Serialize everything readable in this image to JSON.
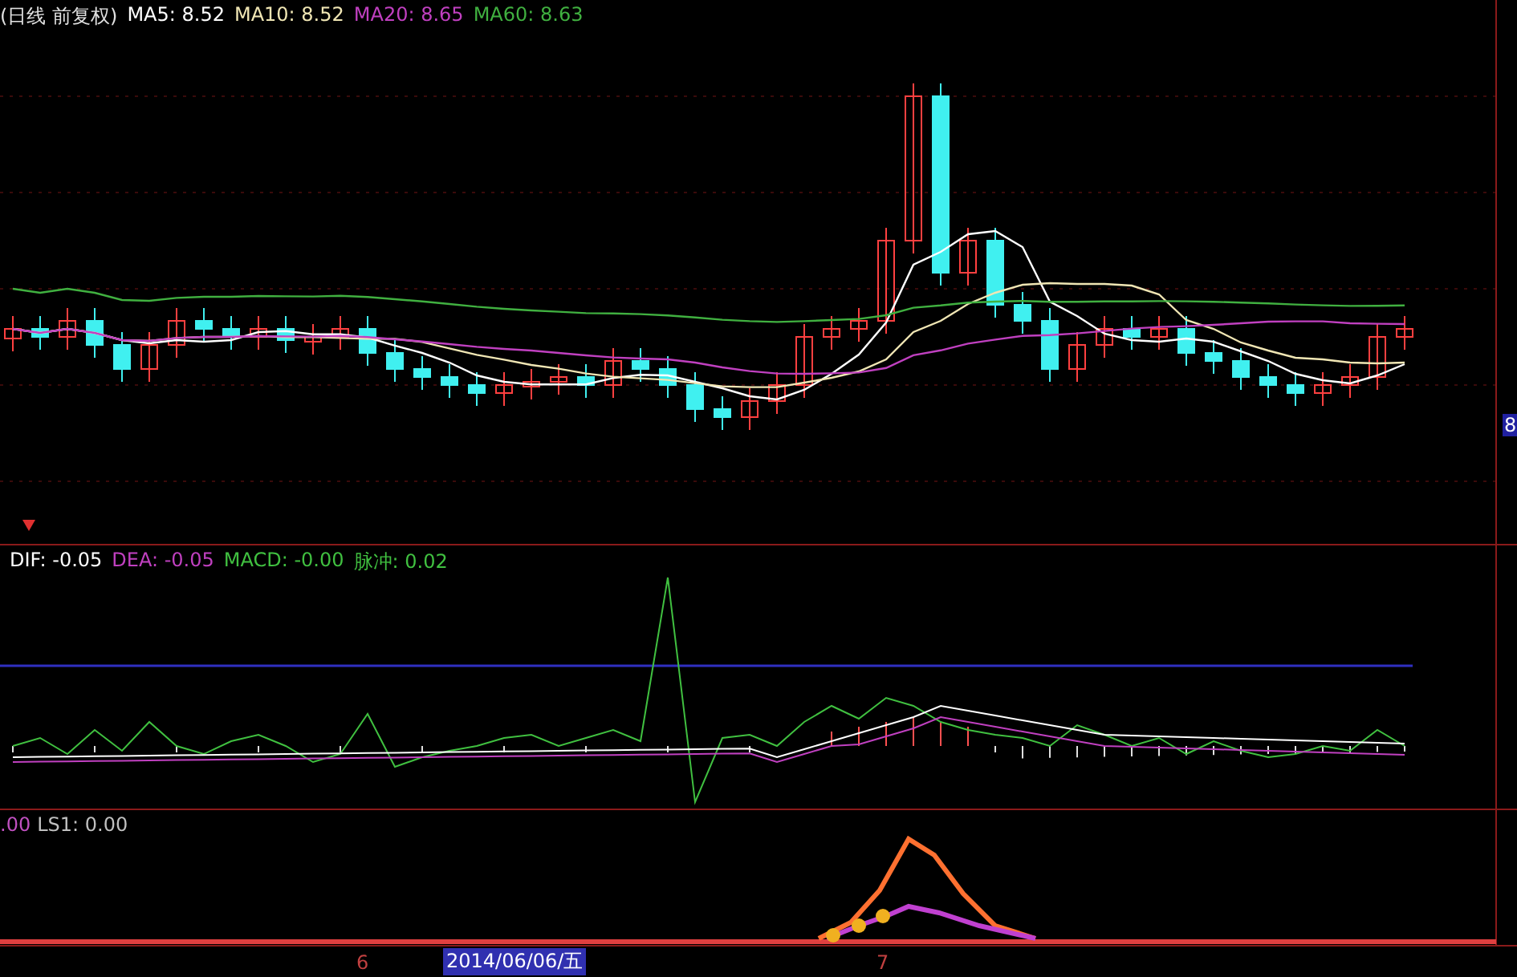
{
  "main_panel": {
    "title": "(日线 前复权)",
    "legend": [
      {
        "label": "MA5: 8.52",
        "color": "#ffffff"
      },
      {
        "label": "MA10: 8.52",
        "color": "#f0e6b4"
      },
      {
        "label": "MA20: 8.65",
        "color": "#c040c0"
      },
      {
        "label": "MA60: 8.63",
        "color": "#40b040"
      }
    ],
    "price_axis_label": "8"
  },
  "macd_panel": {
    "legend": [
      {
        "label": "DIF: -0.05",
        "color": "#ffffff"
      },
      {
        "label": "DEA: -0.05",
        "color": "#c040c0"
      },
      {
        "label": "MACD: -0.00",
        "color": "#40c040"
      },
      {
        "label": "脉冲: 0.02",
        "color": "#40c040"
      }
    ]
  },
  "indicator_panel": {
    "legend": [
      {
        "label": ".00",
        "color": "#c050c0"
      },
      {
        "label": "LS1: 0.00",
        "color": "#c0c0c0"
      }
    ]
  },
  "time_axis": [
    {
      "label": "6",
      "selected": false
    },
    {
      "label": "2014/06/06/五",
      "selected": true
    },
    {
      "label": "7",
      "selected": false
    }
  ]
}
